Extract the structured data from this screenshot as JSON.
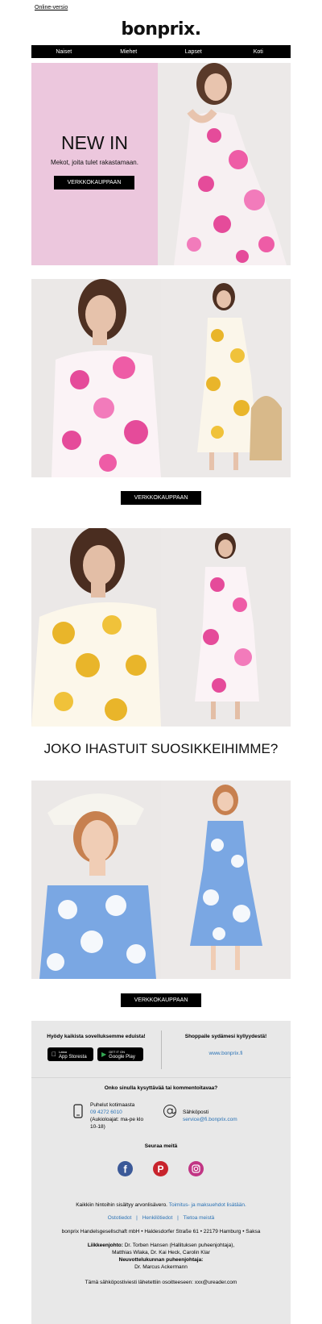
{
  "header": {
    "online_version": "Online-versio",
    "logo": "bonprix."
  },
  "nav": [
    "Naiset",
    "Miehet",
    "Lapset",
    "Koti"
  ],
  "hero": {
    "title": "NEW IN",
    "subtitle": "Mekot, joita tulet rakastamaan.",
    "button": "VERKKOKAUPPAAN"
  },
  "section1": {
    "button": "VERKKOKAUPPAAN"
  },
  "section2": {
    "heading": "JOKO IHASTUIT SUOSIKKEIHIMME?"
  },
  "section3": {
    "button": "VERKKOKAUPPAAN"
  },
  "footer": {
    "app_title": "Hyödy kaikista sovelluksemme eduista!",
    "app_store_small": "Lataa",
    "app_store": "App Storesta",
    "google_play_small": "GET IT ON",
    "google_play": "Google Play",
    "shop_title": "Shoppaile sydämesi kyllyydestä!",
    "website": "www.bonprix.fi",
    "questions_title": "Onko sinulla kysyttävää tai kommentoitavaa?",
    "phone_label": "Puhelut kotimaasta",
    "phone_number": "09 4272 6010",
    "phone_hours_1": "(Aukioloajat: ma-pe klo",
    "phone_hours_2": "10-18)",
    "email_label": "Sähköposti",
    "email_address": "service@fi.bonprix.com",
    "follow_title": "Seuraa meitä",
    "vat_text": "Kaikkiin hintoihin sisältyy arvonlisävero.",
    "terms_link": "Toimitus- ja maksuehdot lisätään.",
    "link_contact": "Ostotiedot",
    "link_privacy": "Henkilötiedot",
    "link_about": "Tietoa meistä",
    "sep": "|",
    "company": "bonprix Handelsgesellschaft mbH • Haldesdorfer Straße 61 • 22179 Hamburg • Saksa",
    "management_label": "Liikkeenjohto:",
    "management_1": "Dr. Torben Hansen (Hallituksen puheenjohtaja),",
    "management_2": "Matthias Wlaka, Dr. Kai Heck, Carolin Klar",
    "board_label": "Neuvottelukunnan puheenjohtaja:",
    "board_name": "Dr. Marcus Ackermann",
    "sent_to": "Tämä sähköpostiviesti lähetettiin osoitteeseen: xxx@ureader.com"
  },
  "colors": {
    "hero_bg": "#ecc7dd",
    "footer_bg": "#e8e8e8",
    "link": "#2a72b5",
    "facebook": "#3b5998",
    "pinterest": "#c8232c",
    "instagram": "#c13584"
  },
  "icons": [
    "apple-icon",
    "google-play-icon",
    "phone-icon",
    "email-at-icon",
    "facebook-icon",
    "pinterest-icon",
    "instagram-icon"
  ]
}
